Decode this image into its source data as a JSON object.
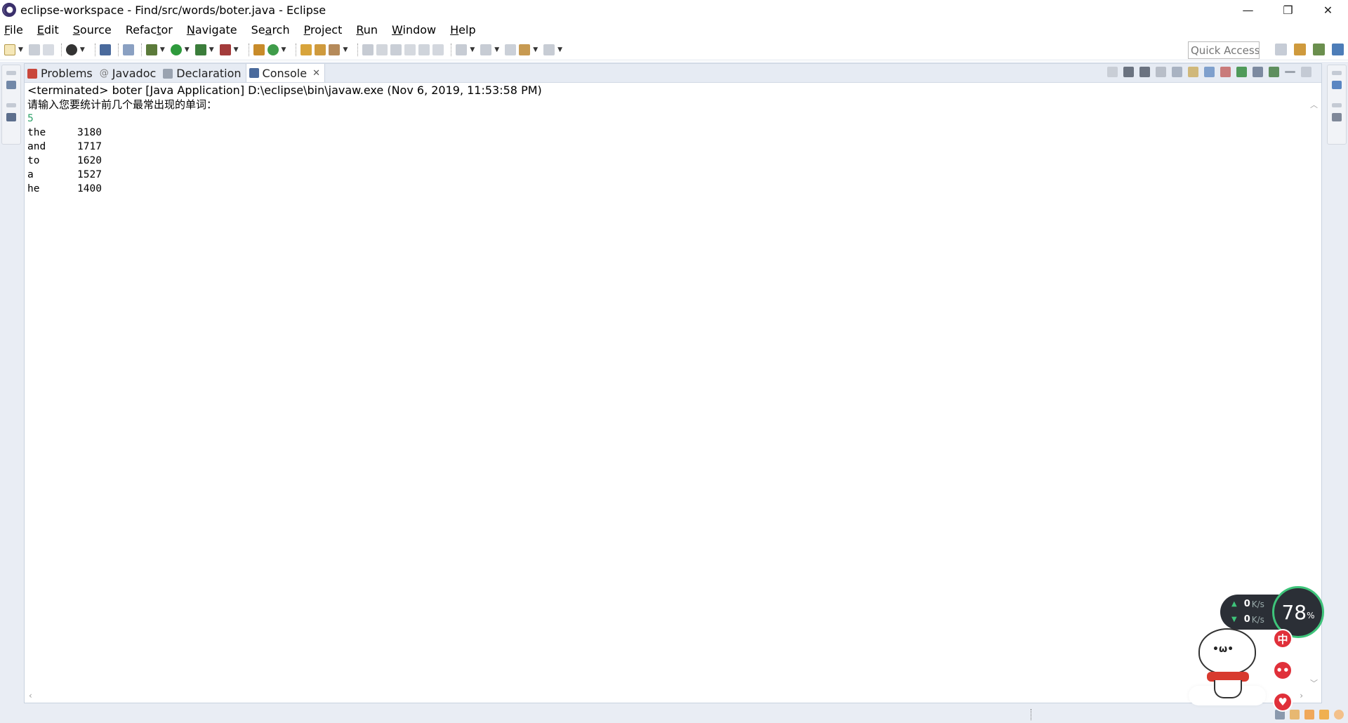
{
  "window": {
    "title": "eclipse-workspace - Find/src/words/boter.java - Eclipse",
    "minimize_glyph": "—",
    "restore_glyph": "❐",
    "close_glyph": "✕"
  },
  "menubar": {
    "items": [
      {
        "accel": "F",
        "rest": "ile"
      },
      {
        "accel": "E",
        "rest": "dit"
      },
      {
        "accel": "S",
        "rest": "ource"
      },
      {
        "accel": "",
        "rest": "Refac",
        "accel2": "t",
        "rest2": "or"
      },
      {
        "accel": "N",
        "rest": "avigate"
      },
      {
        "accel": "",
        "rest": "Se",
        "accel2": "a",
        "rest2": "rch"
      },
      {
        "accel": "P",
        "rest": "roject"
      },
      {
        "accel": "R",
        "rest": "un"
      },
      {
        "accel": "W",
        "rest": "indow"
      },
      {
        "accel": "H",
        "rest": "elp"
      }
    ]
  },
  "toolbar": {
    "quick_access_placeholder": "Quick Access"
  },
  "views": {
    "tabs": [
      {
        "label": "Problems",
        "icon": "problems-icon"
      },
      {
        "label": "Javadoc",
        "icon": "javadoc-icon",
        "prefix": "@"
      },
      {
        "label": "Declaration",
        "icon": "declaration-icon"
      },
      {
        "label": "Console",
        "icon": "console-icon",
        "active": true
      }
    ],
    "close_glyph": "✕"
  },
  "console": {
    "header": "<terminated> boter [Java Application] D:\\eclipse\\bin\\javaw.exe (Nov 6, 2019, 11:53:58 PM)",
    "prompt": "请输入您要统计前几个最常出现的单词：",
    "input": "5",
    "rows": [
      {
        "word": "the",
        "count": "3180"
      },
      {
        "word": "and",
        "count": "1717"
      },
      {
        "word": "to",
        "count": "1620"
      },
      {
        "word": "a",
        "count": "1527"
      },
      {
        "word": "he",
        "count": "1400"
      }
    ]
  },
  "net_widget": {
    "upload": "0",
    "download": "0",
    "unit": "K/s",
    "cpu": "78",
    "cpu_unit": "%",
    "badge_zhong": "中",
    "badge_dots": "••",
    "badge_heart": "♥"
  },
  "mascot": {
    "face": "•ω•"
  },
  "colors": {
    "accent_green": "#2fa36b",
    "trim_bg": "#e9edf4",
    "badge_red": "#e0303a"
  }
}
